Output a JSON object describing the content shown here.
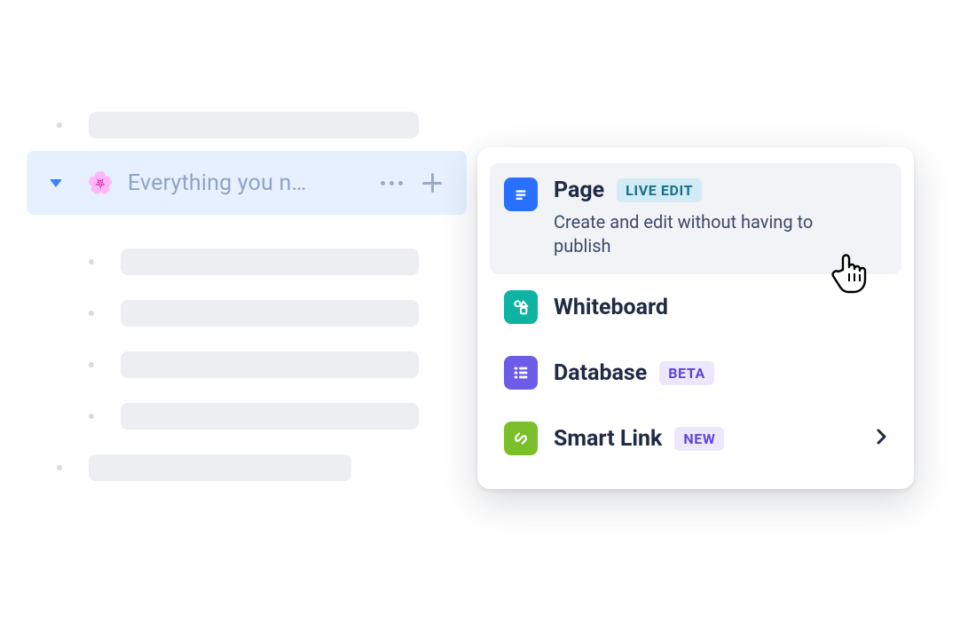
{
  "sidebar": {
    "selected": {
      "emoji": "🌸",
      "label": "Everything you n…"
    }
  },
  "popover": {
    "items": [
      {
        "key": "page",
        "title": "Page",
        "badge": "LIVE EDIT",
        "description": "Create and edit without having to publish"
      },
      {
        "key": "whiteboard",
        "title": "Whiteboard"
      },
      {
        "key": "database",
        "title": "Database",
        "badge": "BETA"
      },
      {
        "key": "smartlink",
        "title": "Smart Link",
        "badge": "NEW"
      }
    ]
  }
}
